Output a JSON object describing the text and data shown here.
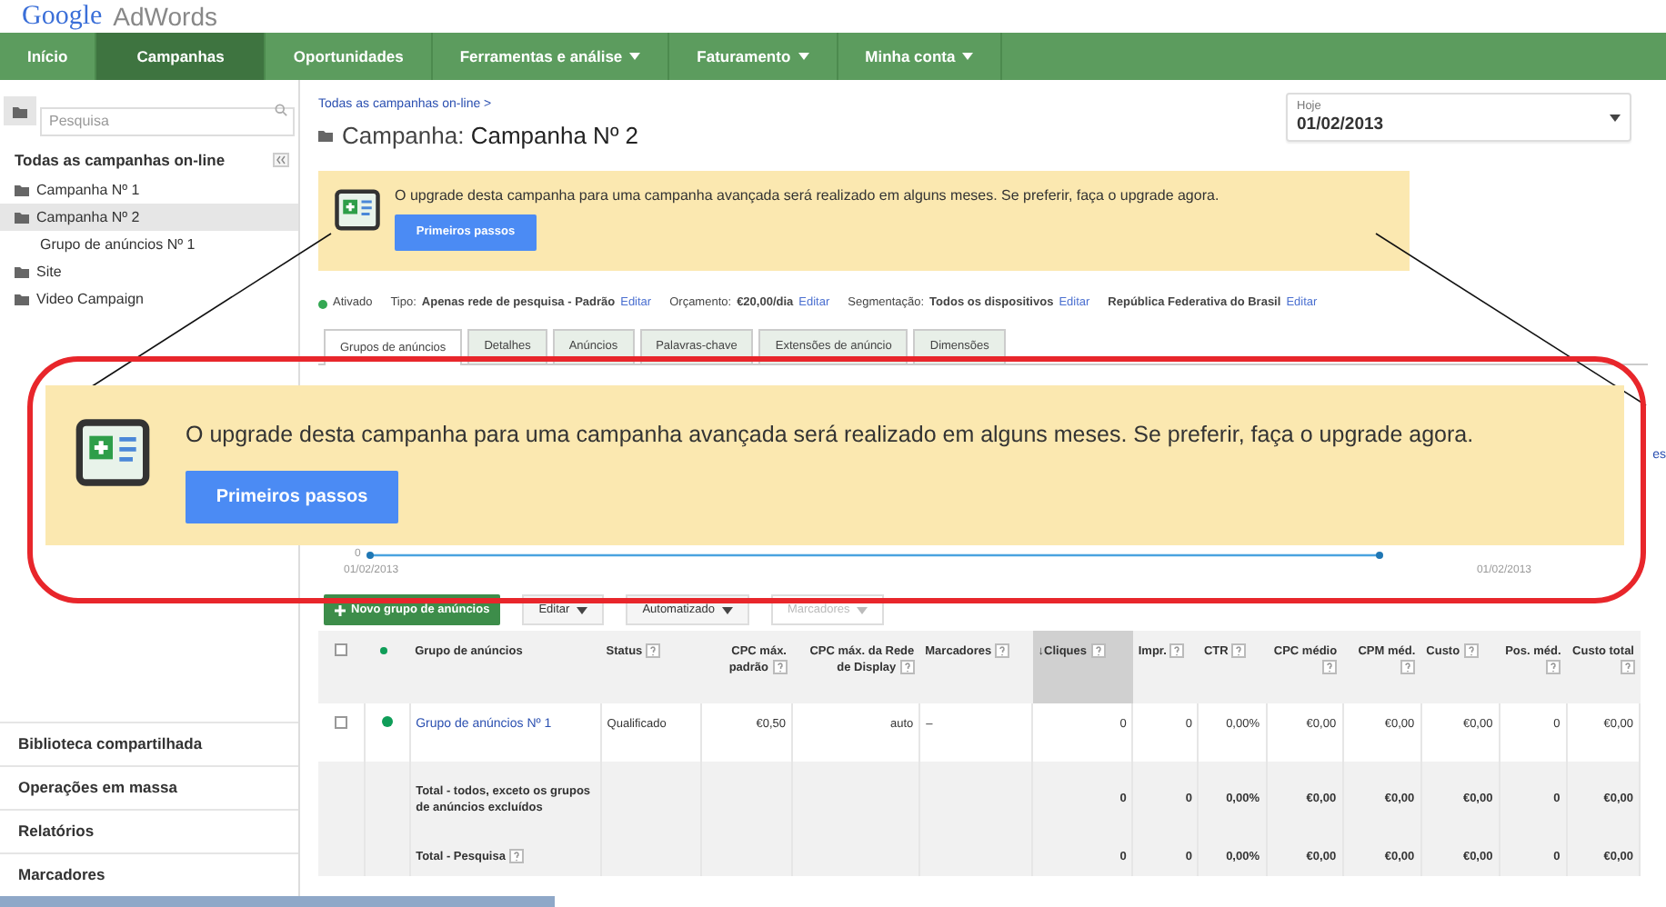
{
  "logo": {
    "brand": "Google",
    "product": "AdWords"
  },
  "nav": [
    {
      "label": "Início",
      "selected": false,
      "dropdown": false
    },
    {
      "label": "Campanhas",
      "selected": true,
      "dropdown": false
    },
    {
      "label": "Oportunidades",
      "selected": false,
      "dropdown": false
    },
    {
      "label": "Ferramentas e análise",
      "selected": false,
      "dropdown": true
    },
    {
      "label": "Faturamento",
      "selected": false,
      "dropdown": true
    },
    {
      "label": "Minha conta",
      "selected": false,
      "dropdown": true
    }
  ],
  "sidebar": {
    "search": {
      "placeholder": "Pesquisa"
    },
    "heading": "Todas as campanhas on-line",
    "tree": [
      {
        "label": "Campanha Nº 1",
        "selected": false
      },
      {
        "label": "Campanha Nº 2",
        "selected": true,
        "children": [
          {
            "label": "Grupo de anúncios Nº 1",
            "selected": false
          }
        ]
      },
      {
        "label": "Site",
        "selected": false
      },
      {
        "label": "Video Campaign",
        "selected": false
      }
    ],
    "links": [
      "Biblioteca compartilhada",
      "Operações em massa",
      "Relatórios",
      "Marcadores"
    ]
  },
  "main": {
    "breadcrumb": "Todas as campanhas on-line >",
    "title_label": "Campanha:",
    "title": "Campanha Nº 2",
    "date_range": {
      "label": "Hoje",
      "value": "01/02/2013"
    },
    "banner": {
      "message": "O upgrade desta campanha para uma campanha avançada será realizado em alguns meses. Se preferir, faça o upgrade agora.",
      "button": "Primeiros passos"
    },
    "status": {
      "label": "Ativado",
      "color": "#34a853"
    },
    "settings": [
      {
        "label": "Tipo:",
        "value": "Apenas rede de pesquisa - Padrão",
        "link": "Editar"
      },
      {
        "label": "Orçamento:",
        "value": "€20,00/dia",
        "link": "Editar"
      },
      {
        "label": "Segmentação:",
        "value": "Todos os dispositivos",
        "link": "Editar"
      },
      {
        "value": "República Federativa do Brasil",
        "link": "Editar"
      }
    ],
    "tabs": [
      {
        "label": "Grupos de anúncios",
        "selected": true
      },
      {
        "label": "Detalhes",
        "selected": false
      },
      {
        "label": "Anúncios",
        "selected": false
      },
      {
        "label": "Palavras-chave",
        "selected": false
      },
      {
        "label": "Extensões de anúncio",
        "selected": false
      },
      {
        "label": "Dimensões",
        "selected": false
      }
    ],
    "side_link": "es",
    "chart": {
      "y_label": "0",
      "start": "01/02/2013",
      "end": "01/02/2013"
    },
    "toolbar": [
      {
        "label": "Novo grupo de anúncios",
        "kind": "primary"
      },
      {
        "label": "Editar",
        "kind": "menu",
        "disabled": false
      },
      {
        "label": "Automatizado",
        "kind": "menu",
        "disabled": false
      },
      {
        "label": "Marcadores",
        "kind": "menu",
        "disabled": true
      }
    ],
    "table": {
      "select_all": {
        "checked": false
      },
      "columns": [
        {
          "kind": "check"
        },
        {
          "kind": "dot"
        },
        {
          "label": "Grupo de anúncios",
          "kind": "text",
          "help": false,
          "sorted": false
        },
        {
          "label": "Status",
          "kind": "text",
          "help": true,
          "sorted": false
        },
        {
          "label": "CPC máx. padrão",
          "kind": "number",
          "help": true,
          "sorted": false
        },
        {
          "label": "CPC máx. da Rede de Display",
          "kind": "number",
          "help": true,
          "sorted": false
        },
        {
          "label": "Marcadores",
          "kind": "text",
          "help": true,
          "sorted": false
        },
        {
          "label": "↓Cliques",
          "kind": "text",
          "help": true,
          "sorted": true
        },
        {
          "label": "Impr.",
          "kind": "text",
          "help": true,
          "sorted": false
        },
        {
          "label": "CTR",
          "kind": "text",
          "help": true,
          "sorted": false
        },
        {
          "label": "CPC médio",
          "kind": "number",
          "help": true,
          "sorted": false
        },
        {
          "label": "CPM méd.",
          "kind": "number",
          "help": true,
          "sorted": false
        },
        {
          "label": "Custo",
          "kind": "text",
          "help": true,
          "sorted": false
        },
        {
          "label": "Pos. méd.",
          "kind": "number",
          "help": true,
          "sorted": false
        },
        {
          "label": "Custo total",
          "kind": "number",
          "help": true,
          "sorted": false
        }
      ],
      "rows": [
        {
          "kind": "item",
          "checked": false,
          "color": "#0f9d58",
          "cells": [
            "",
            "",
            "Grupo de anúncios Nº 1",
            "Qualificado",
            "€0,50",
            "auto",
            "–",
            "0",
            "0",
            "0,00%",
            "€0,00",
            "€0,00",
            "€0,00",
            "0",
            "€0,00"
          ]
        },
        {
          "kind": "total",
          "help": false,
          "cells": [
            "",
            "",
            "Total - todos, exceto os grupos de anúncios excluídos",
            "",
            "",
            "",
            "",
            "0",
            "0",
            "0,00%",
            "€0,00",
            "€0,00",
            "€0,00",
            "0",
            "€0,00"
          ]
        },
        {
          "kind": "total",
          "help": true,
          "cells": [
            "",
            "",
            "Total - Pesquisa",
            "",
            "",
            "",
            "",
            "0",
            "0",
            "0,00%",
            "€0,00",
            "€0,00",
            "€0,00",
            "0",
            "€0,00"
          ]
        }
      ]
    }
  },
  "callout": {
    "message": "O upgrade desta campanha para uma campanha avançada será realizado em alguns meses. Se preferir, faça o upgrade agora.",
    "button": "Primeiros passos"
  }
}
